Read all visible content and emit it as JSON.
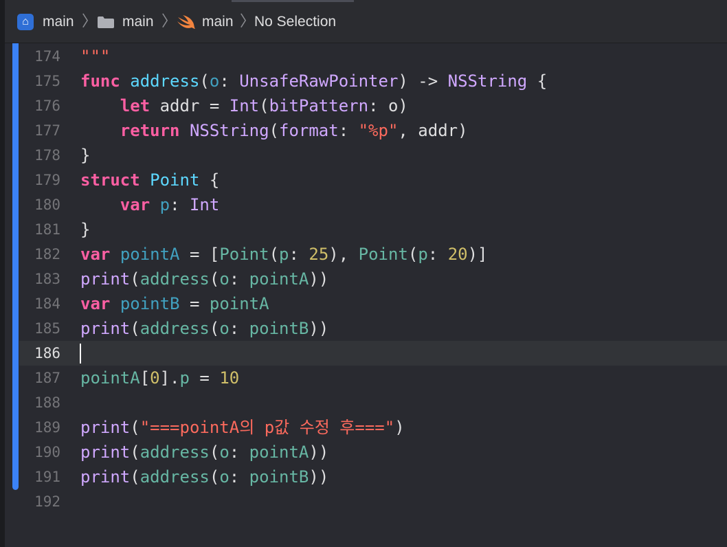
{
  "breadcrumb": {
    "project": "main",
    "folder": "main",
    "file": "main",
    "symbol": "No Selection",
    "separator": "〉",
    "project_icon": "xcode-app-icon",
    "folder_icon": "folder-icon",
    "file_icon": "swift-icon"
  },
  "colors": {
    "keyword": "#fc5fa3",
    "function": "#67b7a4",
    "type": "#d0a8ff",
    "string": "#fc6a5d",
    "number": "#d0bf69",
    "change_bar": "#3b82f6"
  },
  "editor": {
    "current_line": "186",
    "lines": [
      {
        "n": "174"
      },
      {
        "n": "175"
      },
      {
        "n": "176"
      },
      {
        "n": "177"
      },
      {
        "n": "178"
      },
      {
        "n": "179"
      },
      {
        "n": "180"
      },
      {
        "n": "181"
      },
      {
        "n": "182"
      },
      {
        "n": "183"
      },
      {
        "n": "184"
      },
      {
        "n": "185"
      },
      {
        "n": "186"
      },
      {
        "n": "187"
      },
      {
        "n": "188"
      },
      {
        "n": "189"
      },
      {
        "n": "190"
      },
      {
        "n": "191"
      },
      {
        "n": "192"
      }
    ],
    "t": {
      "l174": [
        "\"\"\""
      ],
      "l175": [
        "func",
        " ",
        "address",
        "(",
        "o",
        ": ",
        "UnsafeRawPointer",
        ") -> ",
        "NSString",
        " {"
      ],
      "l176": [
        "    ",
        "let",
        " addr = ",
        "Int",
        "(",
        "bitPattern",
        ": o)"
      ],
      "l177": [
        "    ",
        "return",
        " ",
        "NSString",
        "(",
        "format",
        ": ",
        "\"%p\"",
        ", addr)"
      ],
      "l178": [
        "}"
      ],
      "l179": [
        "struct",
        " ",
        "Point",
        " {"
      ],
      "l180": [
        "    ",
        "var",
        " ",
        "p",
        ": ",
        "Int"
      ],
      "l181": [
        "}"
      ],
      "l182": [
        "var",
        " ",
        "pointA",
        " = [",
        "Point",
        "(",
        "p",
        ": ",
        "25",
        "), ",
        "Point",
        "(",
        "p",
        ": ",
        "20",
        ")]"
      ],
      "l183": [
        "print",
        "(",
        "address",
        "(",
        "o",
        ": ",
        "pointA",
        "))"
      ],
      "l184": [
        "var",
        " ",
        "pointB",
        " = ",
        "pointA"
      ],
      "l185": [
        "print",
        "(",
        "address",
        "(",
        "o",
        ": ",
        "pointB",
        "))"
      ],
      "l187": [
        "pointA",
        "[",
        "0",
        "].",
        "p",
        " = ",
        "10"
      ],
      "l189": [
        "print",
        "(",
        "\"===pointA의 p값 수정 후===\"",
        ")"
      ],
      "l190": [
        "print",
        "(",
        "address",
        "(",
        "o",
        ": ",
        "pointA",
        "))"
      ],
      "l191": [
        "print",
        "(",
        "address",
        "(",
        "o",
        ": ",
        "pointB",
        "))"
      ]
    }
  }
}
